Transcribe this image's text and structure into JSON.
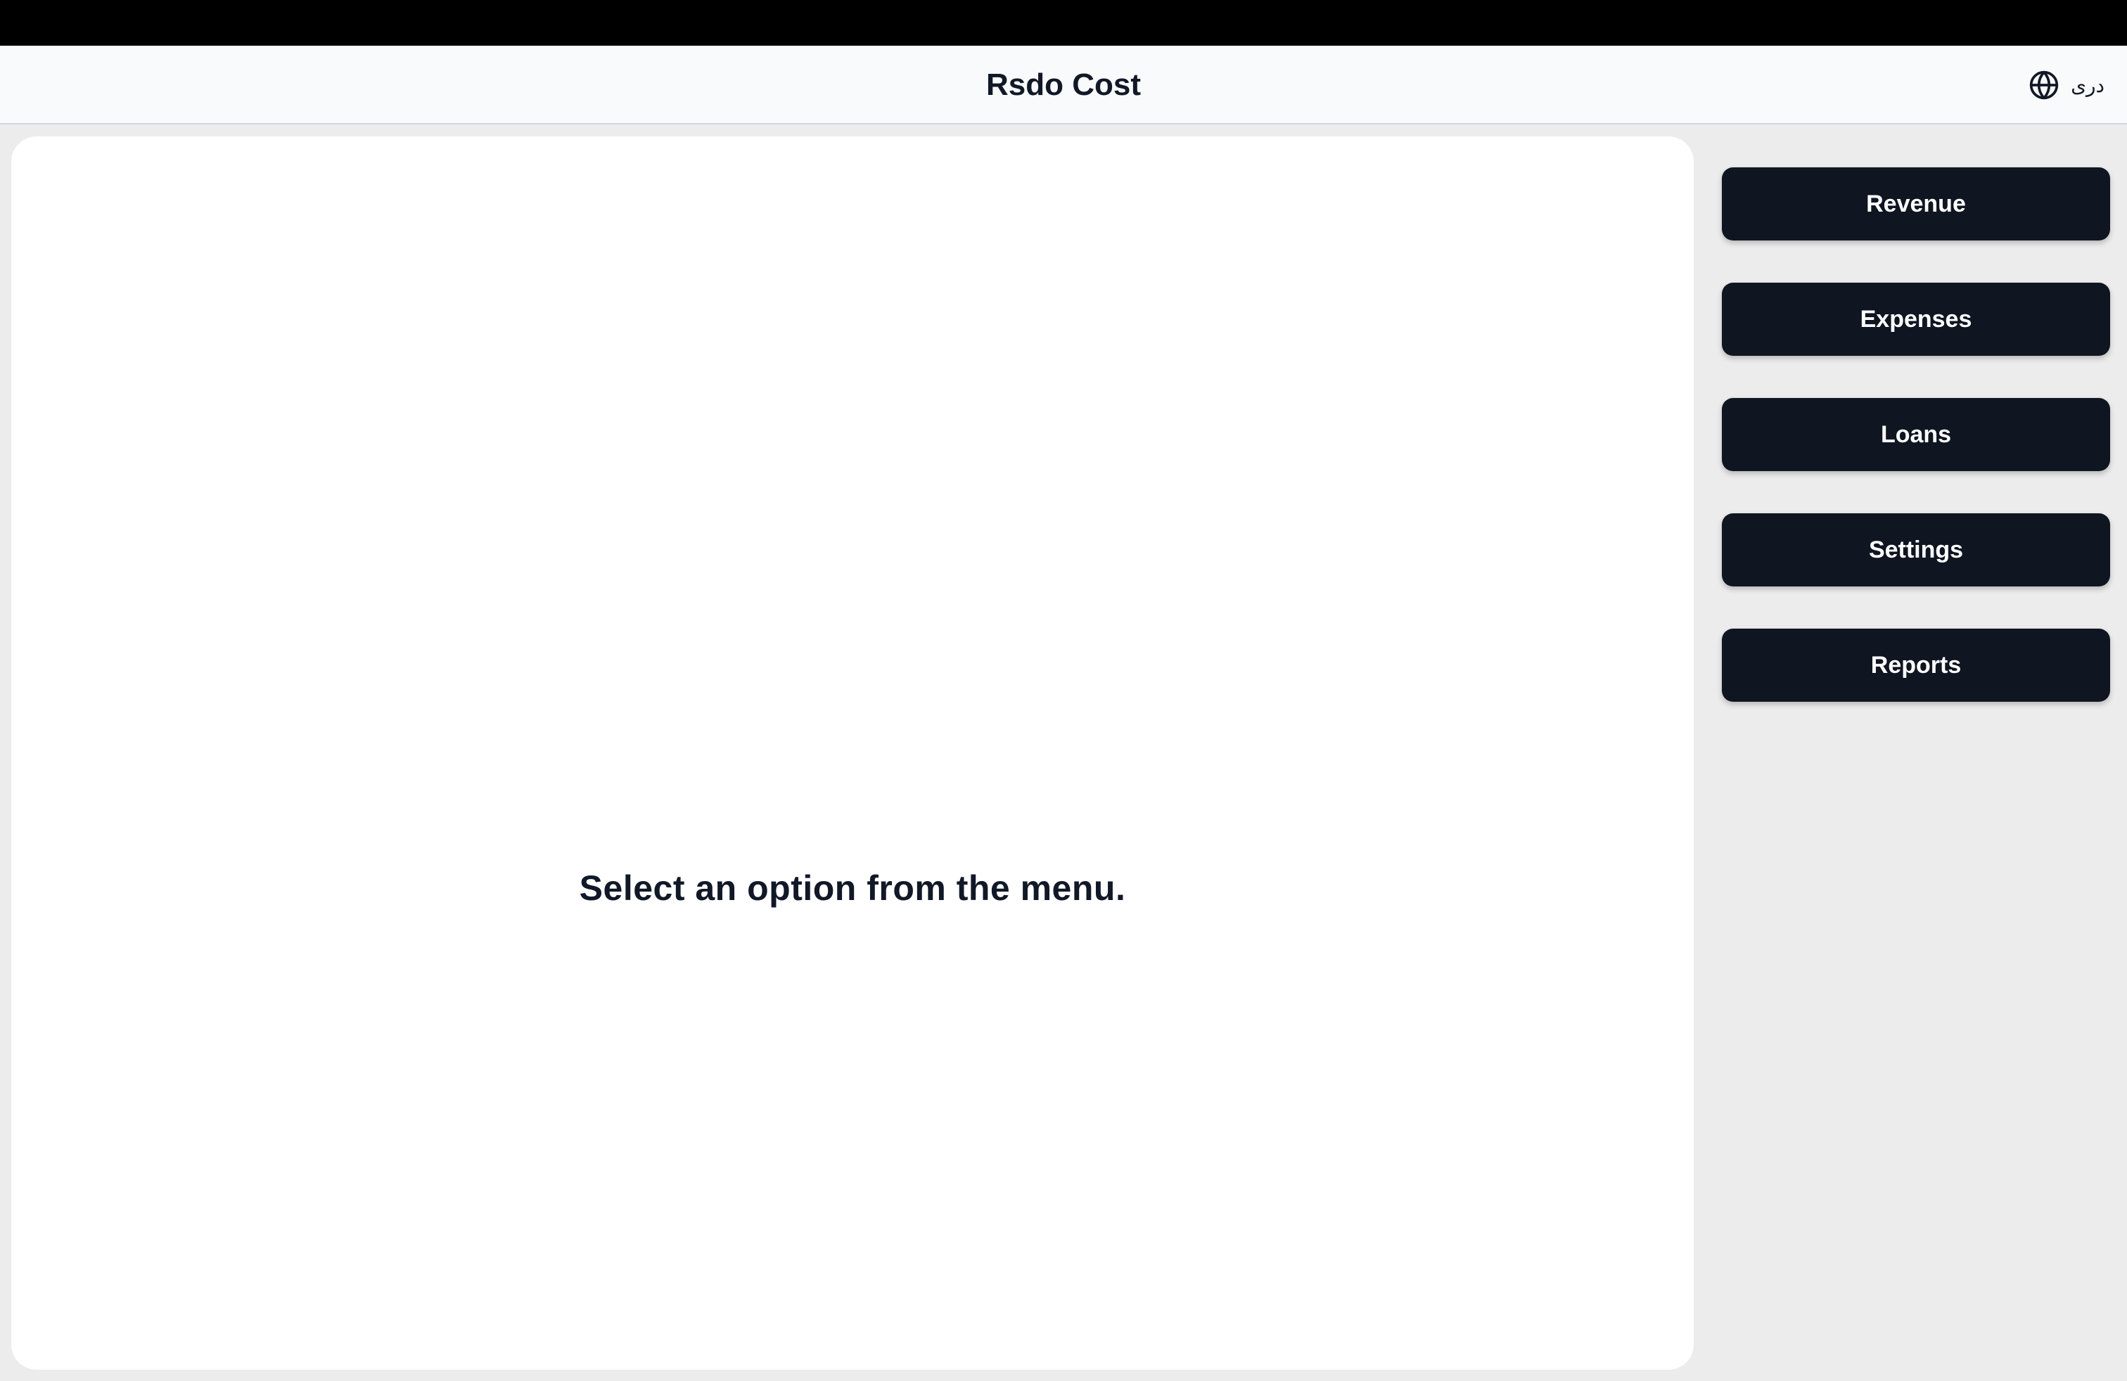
{
  "header": {
    "title": "Rsdo Cost",
    "language": {
      "icon": "globe-icon",
      "label": "دری"
    }
  },
  "main": {
    "placeholder": "Select an option from the menu."
  },
  "menu": {
    "items": [
      {
        "label": "Revenue"
      },
      {
        "label": "Expenses"
      },
      {
        "label": "Loans"
      },
      {
        "label": "Settings"
      },
      {
        "label": "Reports"
      }
    ]
  },
  "colors": {
    "button_bg": "#0f1521",
    "button_text": "#ffffff",
    "page_bg": "#ececec",
    "header_bg": "#f9fafb",
    "text": "#111827"
  }
}
